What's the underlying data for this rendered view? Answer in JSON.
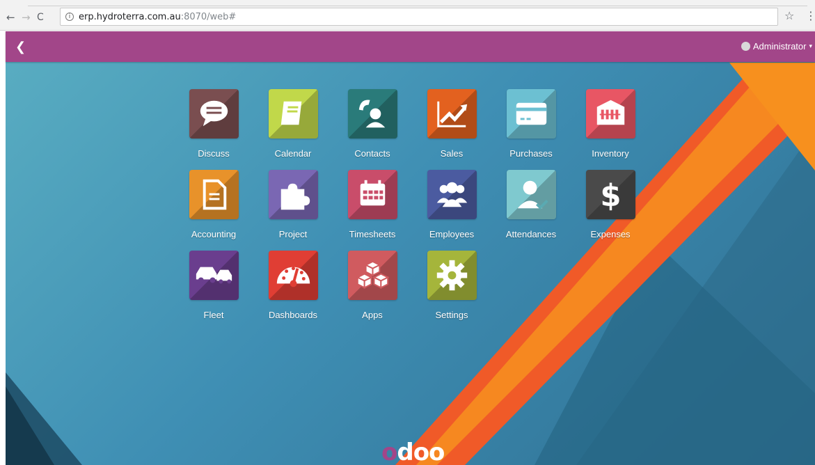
{
  "browser": {
    "back_glyph": "←",
    "forward_glyph": "→",
    "reload_glyph": "C",
    "info_glyph": "i",
    "url_host": "erp.hydroterra.com.au",
    "url_rest": ":8070/web#",
    "star_glyph": "☆",
    "menu_glyph": "⋮"
  },
  "topbar": {
    "back_glyph": "❮",
    "user_name": "Administrator",
    "caret_glyph": "▾",
    "color": "#a24689"
  },
  "apps": [
    {
      "label": "Discuss",
      "icon": "chat-bubble-icon",
      "color": "#7a4e50"
    },
    {
      "label": "Calendar",
      "icon": "notebook-icon",
      "color": "#c1d84a"
    },
    {
      "label": "Contacts",
      "icon": "phone-contact-icon",
      "color": "#2a7b7a"
    },
    {
      "label": "Sales",
      "icon": "trend-chart-icon",
      "color": "#e3611f"
    },
    {
      "label": "Purchases",
      "icon": "credit-card-icon",
      "color": "#6cc0d2"
    },
    {
      "label": "Inventory",
      "icon": "building-icon",
      "color": "#e85664"
    },
    {
      "label": "Accounting",
      "icon": "document-icon",
      "color": "#e8922a"
    },
    {
      "label": "Project",
      "icon": "puzzle-icon",
      "color": "#7a67b3"
    },
    {
      "label": "Timesheets",
      "icon": "calendar-grid-icon",
      "color": "#c94d6a"
    },
    {
      "label": "Employees",
      "icon": "group-icon",
      "color": "#4b5ba0"
    },
    {
      "label": "Attendances",
      "icon": "person-check-icon",
      "color": "#7fc9cf"
    },
    {
      "label": "Expenses",
      "icon": "dollar-icon",
      "color": "#4a4a4a"
    },
    {
      "label": "Fleet",
      "icon": "cars-icon",
      "color": "#6a3e8e"
    },
    {
      "label": "Dashboards",
      "icon": "gauge-icon",
      "color": "#e03e34"
    },
    {
      "label": "Apps",
      "icon": "cubes-icon",
      "color": "#d05b5f"
    },
    {
      "label": "Settings",
      "icon": "gear-icon",
      "color": "#a5b53b"
    }
  ],
  "footer": {
    "logo_o": "o",
    "logo_rest": "doo"
  }
}
